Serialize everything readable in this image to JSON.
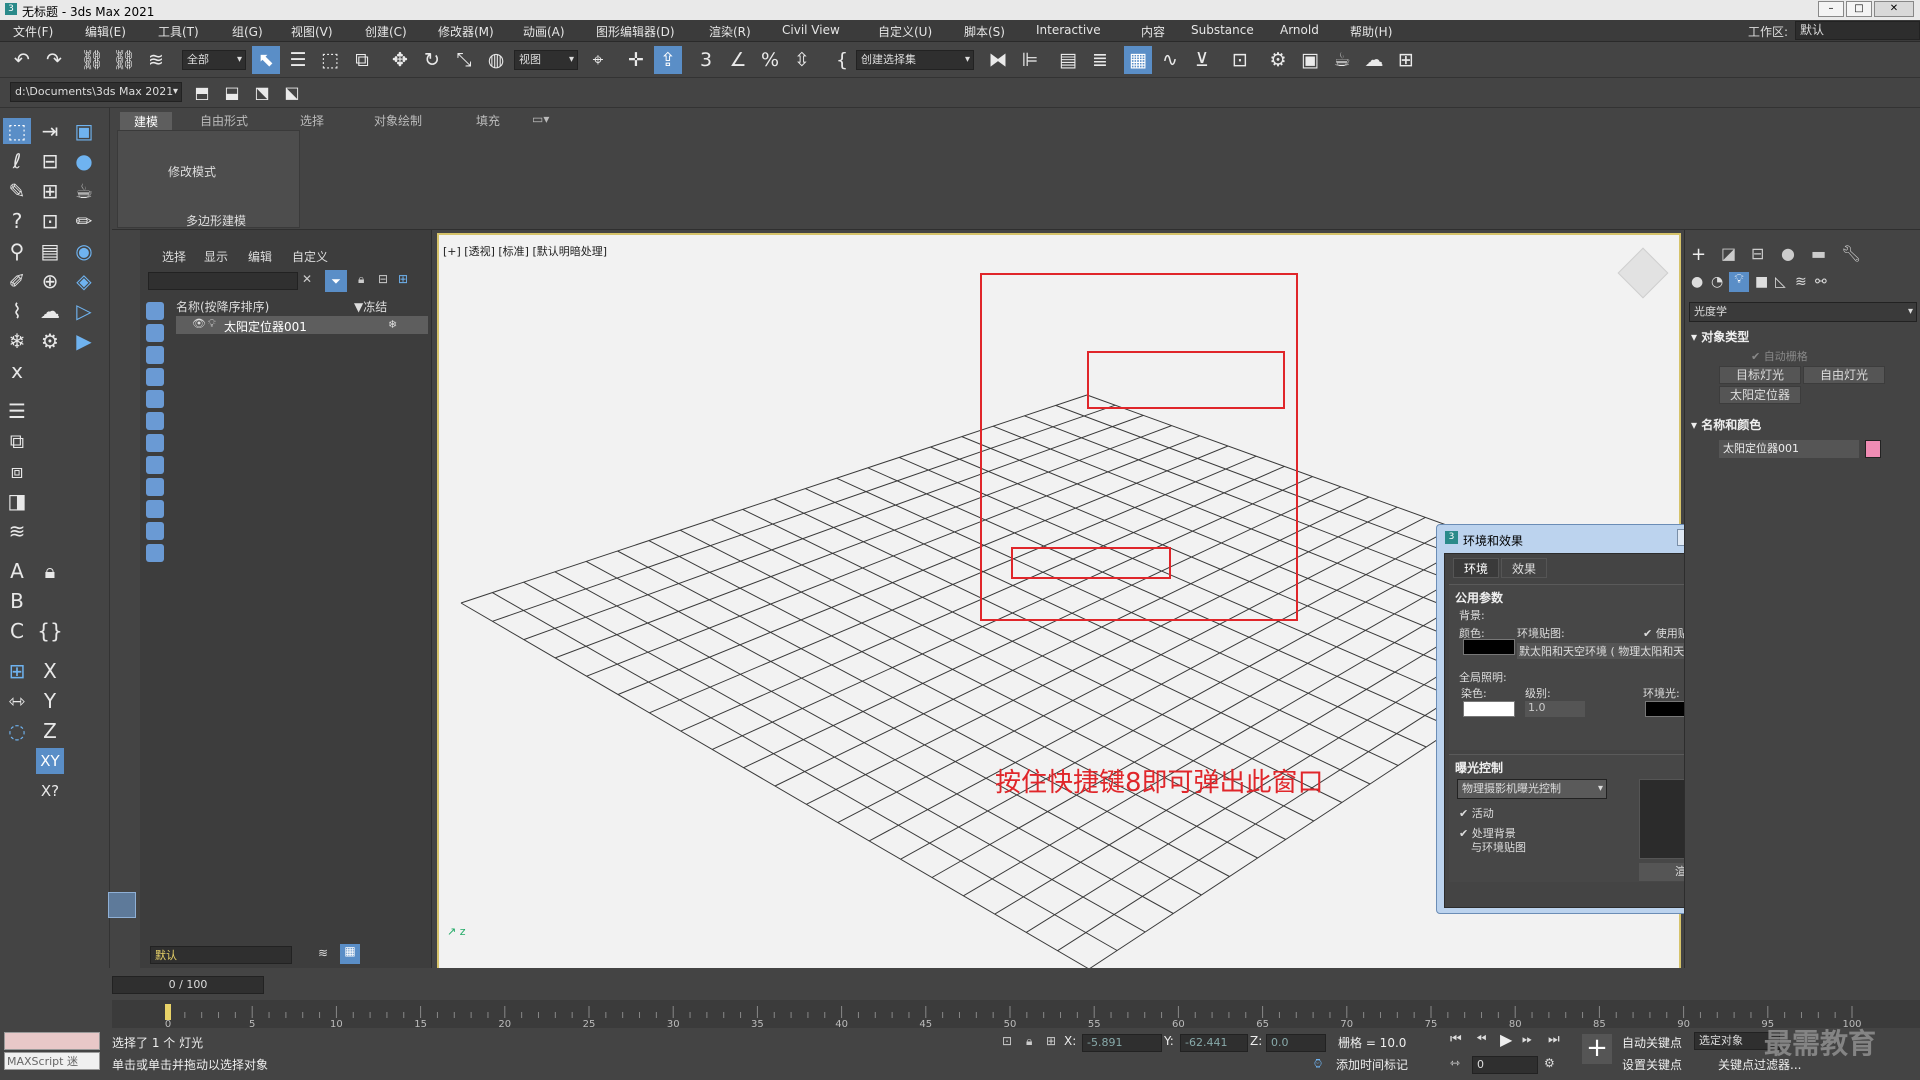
{
  "window": {
    "title": "无标题 - 3ds Max 2021"
  },
  "menu": [
    "文件(F)",
    "编辑(E)",
    "工具(T)",
    "组(G)",
    "视图(V)",
    "创建(C)",
    "修改器(M)",
    "动画(A)",
    "图形编辑器(D)",
    "渲染(R)",
    "Civil View",
    "自定义(U)",
    "脚本(S)",
    "Interactive",
    "内容",
    "Substance",
    "Arnold",
    "帮助(H)"
  ],
  "workspace": {
    "label": "工作区:",
    "value": "默认"
  },
  "toolbar": {
    "filter": "全部",
    "view_ref": "视图",
    "create_selection_set": "创建选择集",
    "path": "d:\\Documents\\3ds Max 2021"
  },
  "ribbon": {
    "tabs": [
      "建模",
      "自由形式",
      "选择",
      "对象绘制",
      "填充"
    ],
    "panel_mode": "修改模式",
    "panel_footer": "多边形建模"
  },
  "scene_explorer": {
    "tabs": [
      "选择",
      "显示",
      "编辑",
      "自定义"
    ],
    "col_name": "名称(按降序排序)",
    "col_freeze": "▼冻结",
    "item": "太阳定位器001",
    "layer": "默认"
  },
  "viewport": {
    "label": "[+] [透视] [标准] [默认明暗处理]"
  },
  "dialog": {
    "title": "环境和效果",
    "tabs": [
      "环境",
      "效果"
    ],
    "common_params": "公用参数",
    "background": "背景:",
    "color": "颜色:",
    "env_map": "环境贴图:",
    "use_map": "使用贴图",
    "env_map_value": "默太阳和天空环境  ( 物理太阳和天空环境)",
    "global_lighting": "全局照明:",
    "tint": "染色:",
    "level": "级别:",
    "level_value": "1.0",
    "ambient": "环境光:",
    "exposure": "曝光控制",
    "exposure_value": "物理摄影机曝光控制",
    "active": "活动",
    "process_bg": "处理背景",
    "process_bg2": "与环境贴图",
    "render_preview": "渲染预览"
  },
  "annotation": "按住快捷键8即可弹出此窗口",
  "command_panel": {
    "dropdown": "光度学",
    "object_type": "对象类型",
    "auto_grid": "自动栅格",
    "target_light": "目标灯光",
    "free_light": "自由灯光",
    "sun_positioner": "太阳定位器",
    "name_color": "名称和颜色",
    "object_name": "太阳定位器001",
    "swatch_color": "#f08cb4"
  },
  "timeline": {
    "slider": "0 / 100",
    "ticks": [
      "0",
      "5",
      "10",
      "15",
      "20",
      "25",
      "30",
      "35",
      "40",
      "45",
      "50",
      "55",
      "60",
      "65",
      "70",
      "75",
      "80",
      "85",
      "90",
      "95",
      "100"
    ]
  },
  "status": {
    "maxscript": "MAXScript 迷",
    "selected": "选择了 1 个 灯光",
    "hint": "单击或单击并拖动以选择对象",
    "x_label": "X:",
    "x_value": "-5.891",
    "y_label": "Y:",
    "y_value": "-62.441",
    "z_label": "Z:",
    "z_value": "0.0",
    "grid": "栅格 = 10.0",
    "add_time_tag": "添加时间标记",
    "auto_key": "自动关键点",
    "set_key": "设置关键点",
    "selected_obj": "选定对象",
    "key_filter": "关键点过滤器...",
    "frame": "0"
  },
  "watermark": "最需教育"
}
